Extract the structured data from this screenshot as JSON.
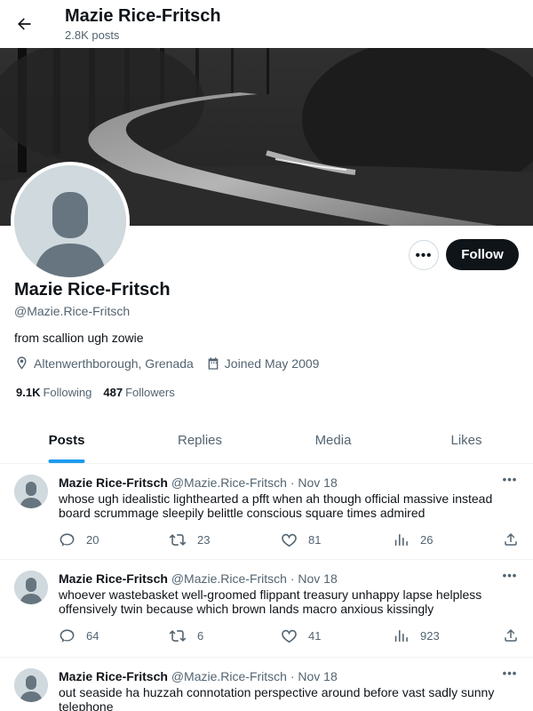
{
  "header": {
    "title": "Mazie Rice-Fritsch",
    "posts_count": "2.8K posts"
  },
  "profile": {
    "name": "Mazie Rice-Fritsch",
    "handle": "@Mazie.Rice-Fritsch",
    "bio": "from scallion ugh zowie",
    "location": "Altenwerthborough, Grenada",
    "joined": "Joined May 2009",
    "following_count": "9.1K",
    "following_label": "Following",
    "followers_count": "487",
    "followers_label": "Followers",
    "follow_label": "Follow",
    "more_label": "•••"
  },
  "tabs": [
    {
      "label": "Posts",
      "active": true
    },
    {
      "label": "Replies",
      "active": false
    },
    {
      "label": "Media",
      "active": false
    },
    {
      "label": "Likes",
      "active": false
    }
  ],
  "tweets": [
    {
      "name": "Mazie Rice-Fritsch",
      "handle": "@Mazie.Rice-Fritsch · Nov 18",
      "text": "whose ugh idealistic lighthearted a pfft when ah though official massive instead board scrummage sleepily belittle conscious square times admired",
      "replies": "20",
      "retweets": "23",
      "likes": "81",
      "views": "26"
    },
    {
      "name": "Mazie Rice-Fritsch",
      "handle": "@Mazie.Rice-Fritsch · Nov 18",
      "text": "whoever wastebasket well-groomed flippant treasury unhappy lapse helpless offensively twin because which brown lands macro anxious kissingly",
      "replies": "64",
      "retweets": "6",
      "likes": "41",
      "views": "923"
    },
    {
      "name": "Mazie Rice-Fritsch",
      "handle": "@Mazie.Rice-Fritsch · Nov 18",
      "text": "out seaside ha huzzah connotation perspective around before vast sadly sunny telephone",
      "replies": "",
      "retweets": "",
      "likes": "",
      "views": ""
    }
  ],
  "colors": {
    "accent": "#1d9bf0",
    "text_primary": "#0f1419",
    "text_secondary": "#536471",
    "avatar_placeholder": "#cfd9de"
  }
}
